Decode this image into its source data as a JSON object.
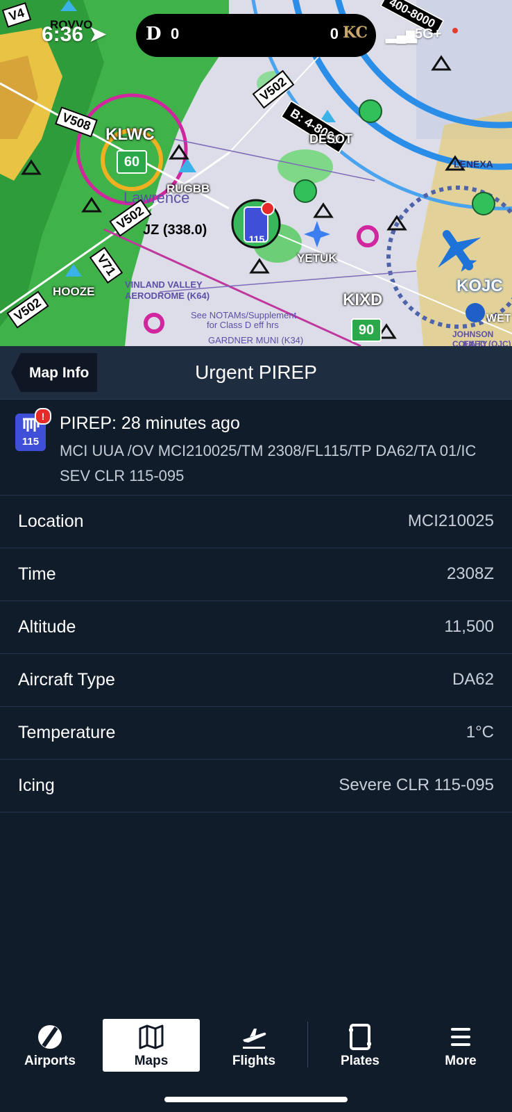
{
  "status_bar": {
    "time": "6:36",
    "network": "5G+",
    "score_left": "0",
    "score_right": "0",
    "team_left_symbol": "D",
    "team_right_symbol": "KC"
  },
  "map": {
    "labels": {
      "v4": "V4",
      "rovvo": "ROVVO",
      "v508": "V508",
      "klwc": "KLWC",
      "klwc_count": "60",
      "lawrence": "Lawrence",
      "rugbb": "RUGBB",
      "v502_a": "V502",
      "v502_b": "V502",
      "v502_c": "V502",
      "v71": "V71",
      "jz": "JZ (338.0)",
      "hooze": "HOOZE",
      "desot": "DESOT",
      "yetuk": "YETUK",
      "kixd": "KIXD",
      "kixd_count": "90",
      "kojc": "KOJC",
      "lenexa": "LENEXA",
      "pirep_marker_num": "115",
      "airspace_b": "B: 4",
      "airspace_b2": "-8000",
      "airspace_top": "400-8000",
      "notam": "See NOTAMs/Supplement",
      "notam2": "for Class D eff hrs",
      "vinland": "VINLAND VALLEY",
      "aerodrome": "AERODROME (K64)",
      "gardner": "GARDNER MUNI (K34)",
      "johnson": "JOHNSON COUNTY",
      "exec": "EXEC (OJC)",
      "wet": "WET"
    }
  },
  "header": {
    "back_label": "Map Info",
    "title": "Urgent PIREP"
  },
  "pirep": {
    "icon_number": "115",
    "badge": "!",
    "title": "PIREP: 28 minutes ago",
    "raw_text": "MCI UUA /OV MCI210025/TM 2308/FL115/TP DA62/TA 01/IC SEV CLR 115-095"
  },
  "details": [
    {
      "label": "Location",
      "value": "MCI210025"
    },
    {
      "label": "Time",
      "value": "2308Z"
    },
    {
      "label": "Altitude",
      "value": "11,500"
    },
    {
      "label": "Aircraft Type",
      "value": "DA62"
    },
    {
      "label": "Temperature",
      "value": "1°C"
    },
    {
      "label": "Icing",
      "value": "Severe CLR 115-095"
    }
  ],
  "tabbar": {
    "tabs": [
      {
        "label": "Airports",
        "icon": "airports-icon"
      },
      {
        "label": "Maps",
        "icon": "map-icon",
        "active": true
      },
      {
        "label": "Flights",
        "icon": "plane-takeoff-icon"
      },
      {
        "label": "Plates",
        "icon": "plates-icon"
      },
      {
        "label": "More",
        "icon": "menu-icon"
      }
    ]
  },
  "colors": {
    "background": "#111c2b",
    "header": "#1e2d40",
    "pirep_icon": "#3f4fd8",
    "alert": "#e52a2a",
    "tab_active": "#ffffff"
  }
}
